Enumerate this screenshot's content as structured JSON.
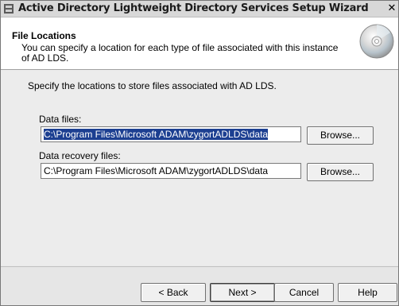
{
  "window": {
    "title": "Active Directory Lightweight Directory Services Setup Wizard",
    "close_glyph": "✕"
  },
  "header": {
    "title": "File Locations",
    "subtitle": "You can specify a location for each type of file associated with this instance of AD LDS."
  },
  "main": {
    "intro": "Specify the locations to store files associated with AD LDS.",
    "data_files": {
      "label": "Data files:",
      "value": "C:\\Program Files\\Microsoft ADAM\\zygortADLDS\\data",
      "browse_label": "Browse..."
    },
    "recovery_files": {
      "label": "Data recovery files:",
      "value": "C:\\Program Files\\Microsoft ADAM\\zygortADLDS\\data",
      "browse_label": "Browse..."
    }
  },
  "footer": {
    "back_label": "< Back",
    "next_label": "Next >",
    "cancel_label": "Cancel",
    "help_label": "Help"
  },
  "colors": {
    "selection": "#1c3f91",
    "header_bg": "#ffffff",
    "body_bg": "#ececec"
  },
  "icons": [
    "app-icon",
    "close-icon",
    "cd-disc-icon"
  ]
}
